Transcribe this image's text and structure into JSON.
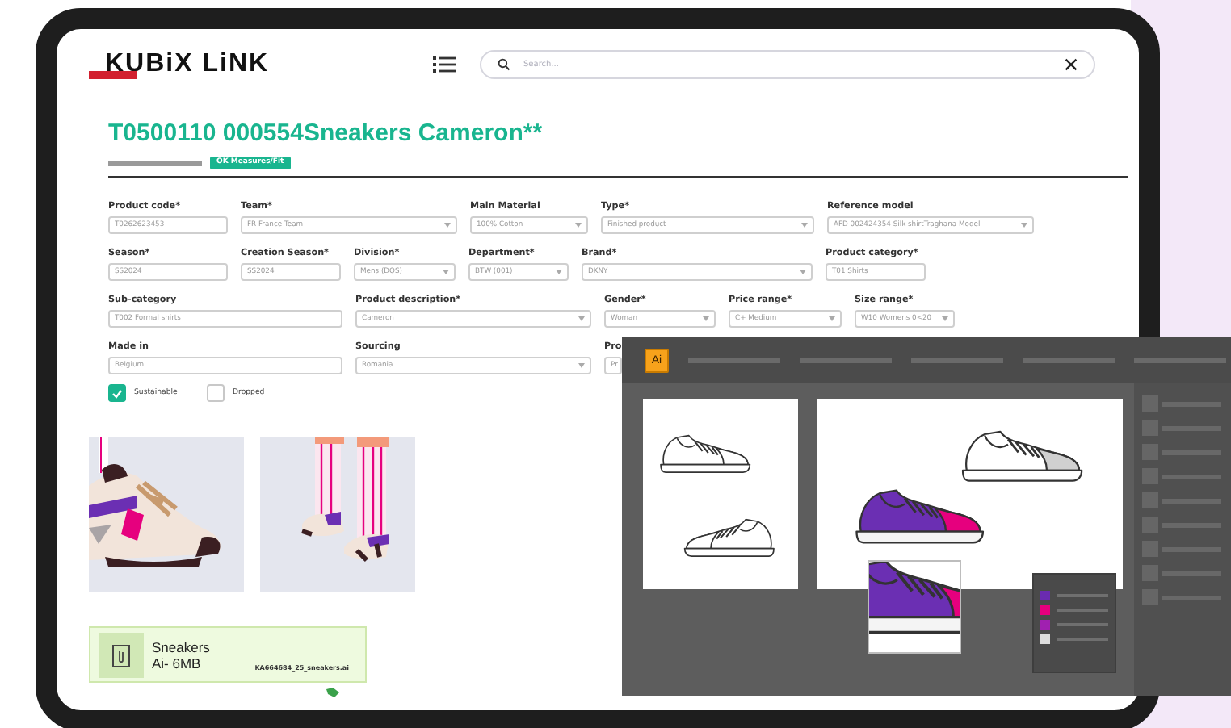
{
  "header": {
    "logo": "KUBiX LiNK",
    "search": {
      "placeholder": "Search..."
    }
  },
  "product": {
    "title": "T0500110 000554Sneakers Cameron**",
    "status": "OK Measures/Fit"
  },
  "form": {
    "fields": [
      {
        "label": "Product code*",
        "value": "T0262623453",
        "kind": "text"
      },
      {
        "label": "Team*",
        "value": "FR France Team",
        "kind": "select"
      },
      {
        "label": "Main Material",
        "value": "100% Cotton",
        "kind": "select"
      },
      {
        "label": "Type*",
        "value": "Finished product",
        "kind": "select"
      },
      {
        "label": "Reference model",
        "value": "AFD 002424354 Silk shirtTraghana Model",
        "kind": "select"
      },
      {
        "label": "Season*",
        "value": "SS2024",
        "kind": "text"
      },
      {
        "label": "Creation Season*",
        "value": "SS2024",
        "kind": "text"
      },
      {
        "label": "Division*",
        "value": "Mens (DOS)",
        "kind": "select"
      },
      {
        "label": "Department*",
        "value": "BTW (001)",
        "kind": "select"
      },
      {
        "label": "Brand*",
        "value": "DKNY",
        "kind": "select"
      },
      {
        "label": "Product category*",
        "value": "T01 Shirts",
        "kind": "text"
      },
      {
        "label": "Sub-category",
        "value": "T002 Formal shirts",
        "kind": "text"
      },
      {
        "label": "Product description*",
        "value": "Cameron",
        "kind": "select"
      },
      {
        "label": "Gender*",
        "value": "Woman",
        "kind": "select"
      },
      {
        "label": "Price range*",
        "value": "C+ Medium",
        "kind": "select"
      },
      {
        "label": "Size range*",
        "value": "W10 Womens 0<20",
        "kind": "select"
      },
      {
        "label": "Made in",
        "value": "Belgium",
        "kind": "text"
      },
      {
        "label": "Sourcing",
        "value": "Romania",
        "kind": "select"
      },
      {
        "label": "Pro",
        "value": "Pr",
        "kind": "text"
      }
    ]
  },
  "checkboxes": [
    {
      "label": "Sustainable",
      "checked": true
    },
    {
      "label": "Dropped",
      "checked": false
    }
  ],
  "attachment": {
    "name": "Sneakers",
    "meta": "Ai- 6MB",
    "file": "KA664684_25_sneakers.ai"
  },
  "design_app": {
    "logo": "Ai",
    "swatches": [
      {
        "color": "#6a2bb0"
      },
      {
        "color": "#e6007e"
      },
      {
        "color": "#a020b0"
      },
      {
        "color": "#dddddd"
      }
    ]
  }
}
